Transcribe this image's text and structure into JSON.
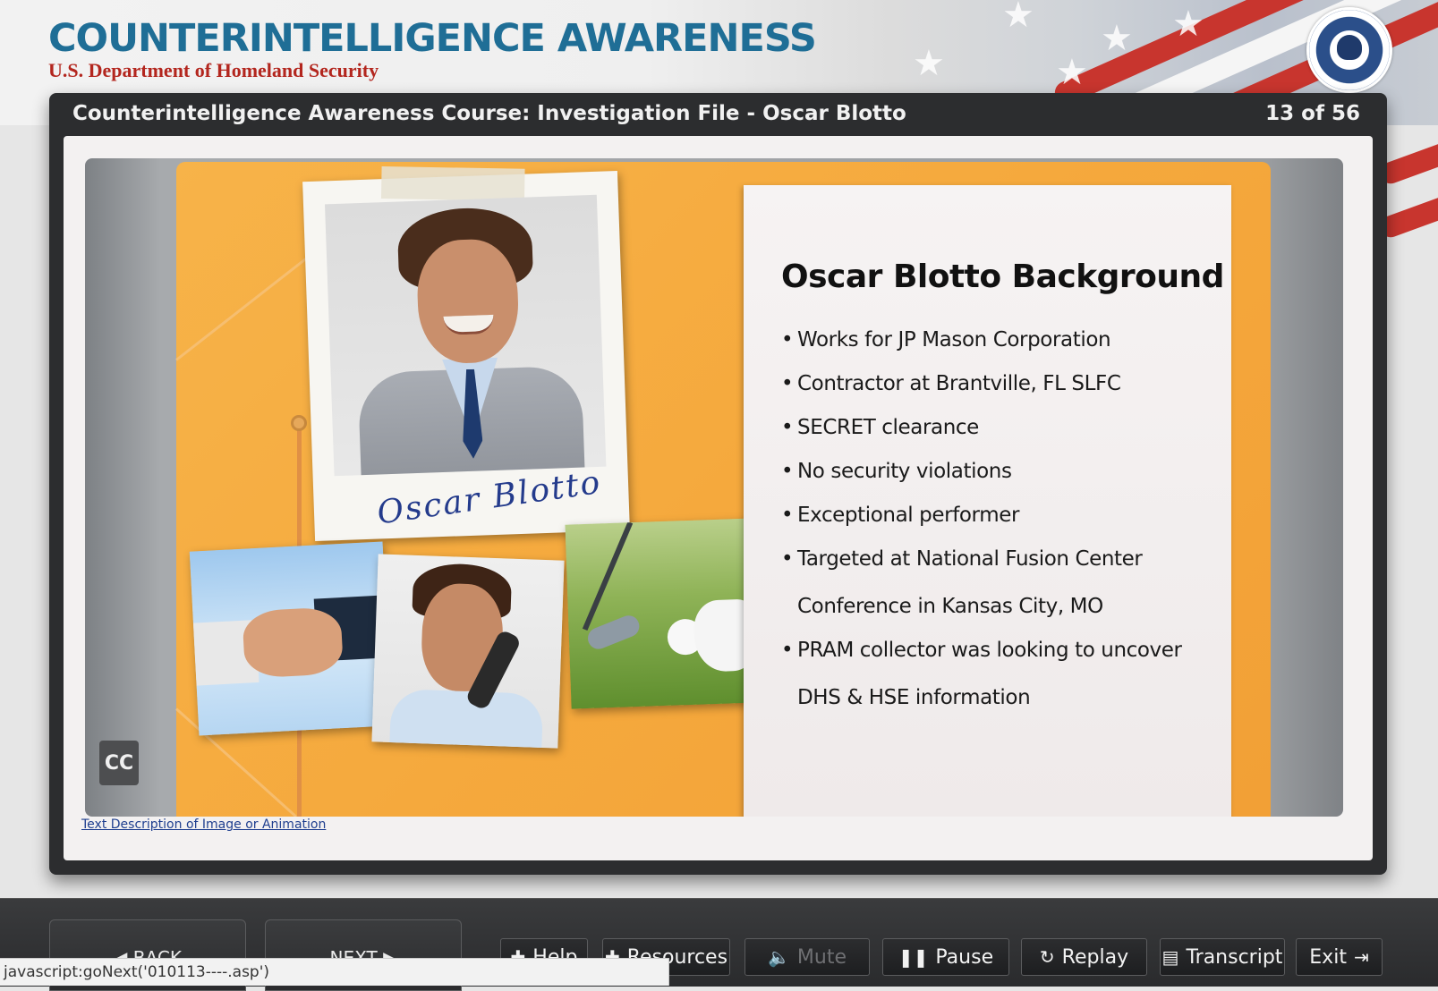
{
  "header": {
    "title": "COUNTERINTELLIGENCE AWARENESS",
    "subtitle": "U.S. Department of Homeland Security"
  },
  "course": {
    "title": "Counterintelligence Awareness Course: Investigation File - Oscar Blotto",
    "page_count": "13 of 56"
  },
  "slide": {
    "signature": "Oscar Blotto",
    "notes_title": "Oscar Blotto Background",
    "bullets": [
      {
        "text": "Works for JP Mason Corporation",
        "cont": ""
      },
      {
        "text": "Contractor at Brantville, FL SLFC",
        "cont": ""
      },
      {
        "text": "SECRET clearance",
        "cont": ""
      },
      {
        "text": "No security violations",
        "cont": ""
      },
      {
        "text": "Exceptional performer",
        "cont": ""
      },
      {
        "text": "Targeted at National Fusion Center",
        "cont": "Conference in Kansas City, MO"
      },
      {
        "text": "PRAM collector was looking to uncover",
        "cont": "DHS & HSE information"
      }
    ],
    "cc_label": "CC",
    "description_link": "Text Description of Image or Animation"
  },
  "nav": {
    "back": "BACK",
    "next": "NEXT",
    "help": "Help",
    "resources": "Resources",
    "mute": "Mute",
    "pause": "Pause",
    "replay": "Replay",
    "transcript": "Transcript",
    "exit": "Exit"
  },
  "status_bar": "javascript:goNext('010113----.asp')",
  "colors": {
    "title_blue": "#1f6e96",
    "subtitle_red": "#b3261e",
    "folder_orange": "#f5a93d",
    "frame_dark": "#2c2d2f"
  }
}
